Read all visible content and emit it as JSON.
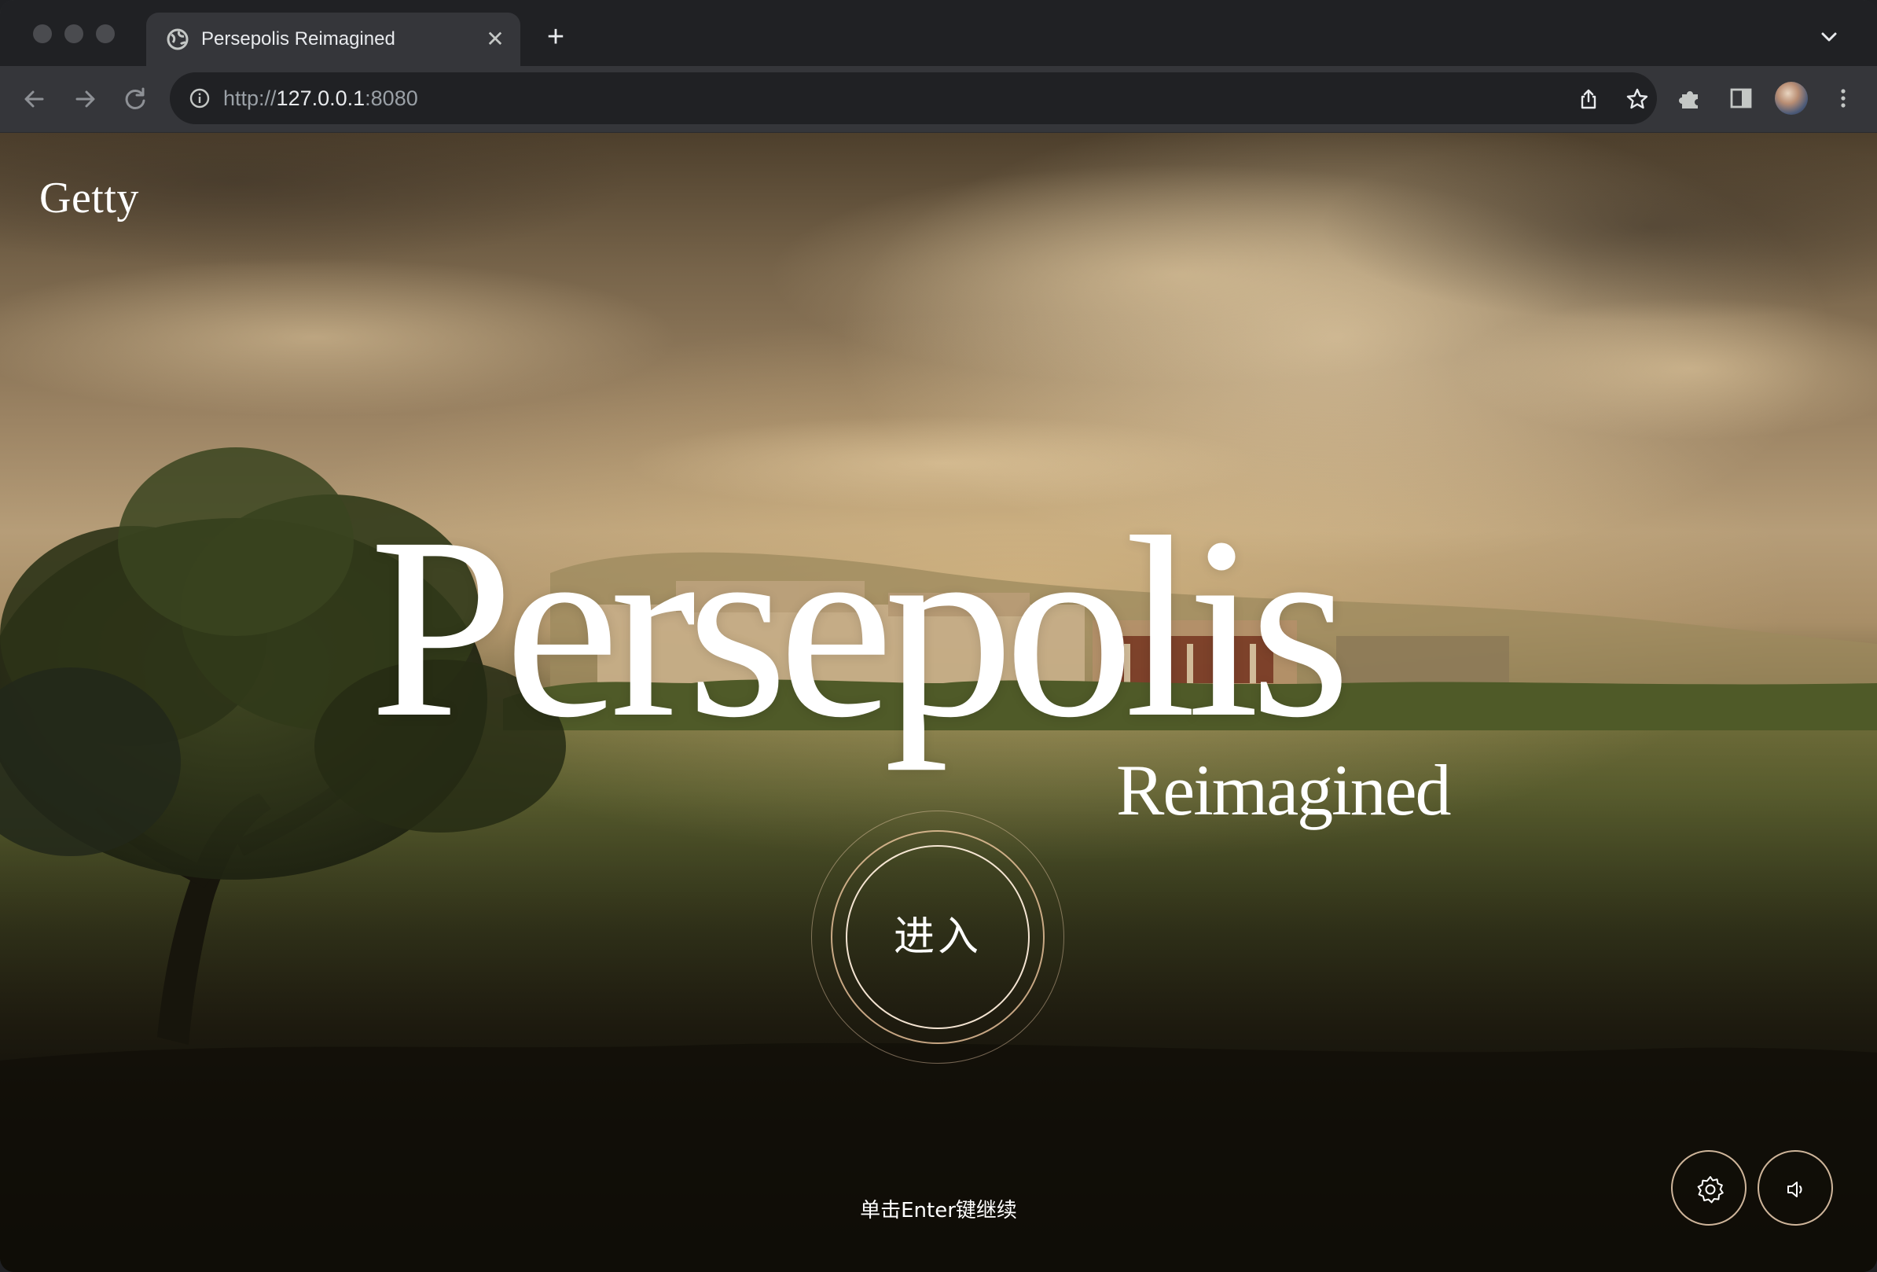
{
  "browser": {
    "tab": {
      "title": "Persepolis Reimagined",
      "close_glyph": "✕",
      "favicon": "globe-icon"
    },
    "new_tab_glyph": "+",
    "address": {
      "scheme": "http://",
      "host": "127.0.0.1",
      "port": ":8080"
    },
    "icons": [
      "back-icon",
      "forward-icon",
      "reload-icon",
      "info-icon",
      "share-icon",
      "bookmark-star-icon",
      "extensions-icon",
      "side-panel-icon",
      "profile-avatar",
      "kebab-menu-icon",
      "tab-search-icon"
    ]
  },
  "page": {
    "brand": "Getty",
    "title": "Persepolis",
    "subtitle": "Reimagined",
    "enter_button": "进入",
    "hint": "单击Enter键继续",
    "controls": {
      "settings": "settings-icon",
      "sound": "sound-icon"
    }
  },
  "colors": {
    "browser_frame": "#202124",
    "toolbar": "#35363a",
    "omnibox": "#202124",
    "ring_accent": "#f0c8a0",
    "text": "#ffffff"
  }
}
